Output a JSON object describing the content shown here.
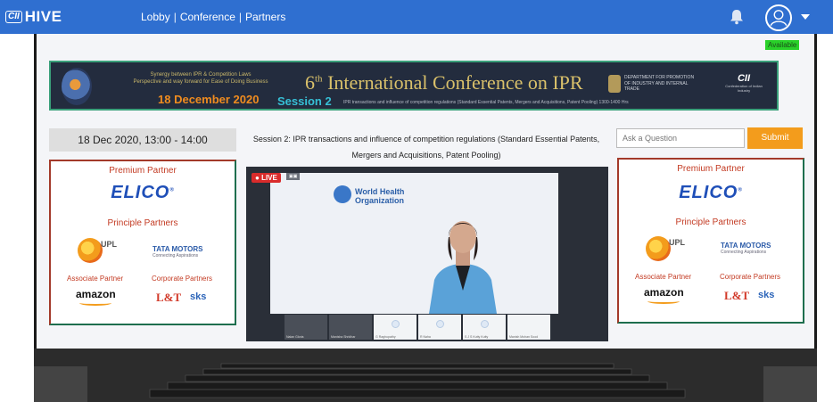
{
  "header": {
    "logo_cii": "CII",
    "logo_hive": "HIVE",
    "nav": [
      "Lobby",
      "Conference",
      "Partners"
    ],
    "nav_separator": "|"
  },
  "status": {
    "available": "Available"
  },
  "banner": {
    "synergy_line1": "Synergy between IPR & Competition Laws",
    "synergy_line2": "Perspective and way forward for Ease of Doing Business",
    "date": "18 December 2020",
    "edition": "6",
    "edition_suffix": "th",
    "conference_title": "International Conference on IPR",
    "session": "Session 2",
    "session_desc": "IPR transactions and influence of competition regulations (Standard Essential Patents, Mergers and Acquisitions, Patent Pooling) 1300-1400 Hrs",
    "dept": "DEPARTMENT FOR PROMOTION OF INDUSTRY AND INTERNAL TRADE",
    "cii_name": "CII",
    "cii_tagline": "Confederation of Indian Industry"
  },
  "session_time": "18 Dec 2020, 13:00 - 14:00",
  "session_title": "Session 2: IPR transactions and influence of competition regulations (Standard Essential Patents, Mergers and Acquisitions, Patent Pooling)",
  "question": {
    "placeholder": "Ask a Question",
    "submit_label": "Submit"
  },
  "partners": {
    "premium_heading": "Premium Partner",
    "premium_name": "ELICO",
    "principle_heading": "Principle Partners",
    "upl": "UPL",
    "tata": "TATA MOTORS",
    "tata_tagline": "Connecting Aspirations",
    "associate_heading": "Associate Partner",
    "associate_name": "amazon",
    "corporate_heading": "Corporate Partners",
    "lt": "L&T",
    "sks": "sks"
  },
  "video": {
    "live_label": "LIVE",
    "org_line1": "World Health",
    "org_line2": "Organization",
    "participants": [
      "Nalan Gloria",
      "Manisha Shridhar",
      "G Raghupathy",
      "R Naha",
      "S J S Kutty Kutty",
      "Manish Mohan Sood"
    ]
  },
  "colors": {
    "topbar": "#2f6fd0",
    "accent": "#f39c1c",
    "live": "#d92b2b",
    "partner_heading": "#c33a22"
  }
}
